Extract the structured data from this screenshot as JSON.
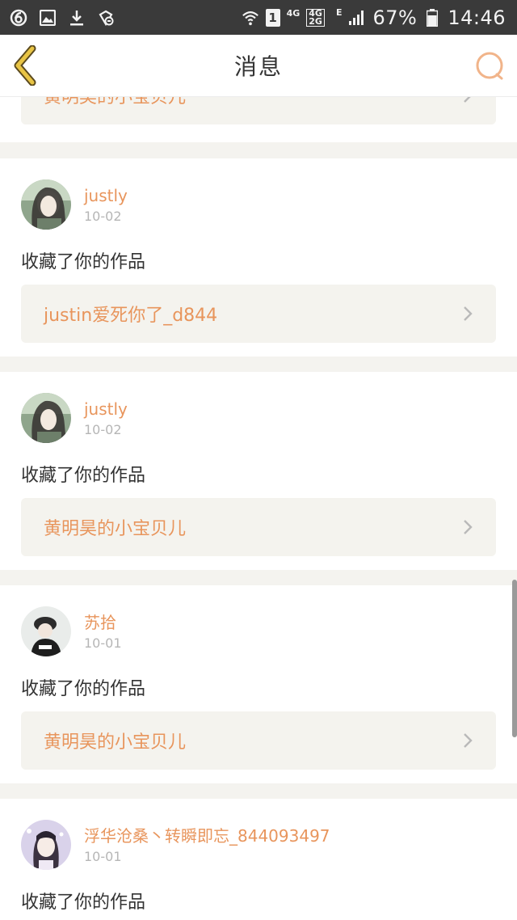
{
  "status_bar": {
    "network_small": "4G",
    "network_dual_top": "4G",
    "network_dual_bottom": "2G",
    "data_mode": "E",
    "sim_label": "1",
    "battery": "67%",
    "time": "14:46"
  },
  "header": {
    "title": "消息"
  },
  "colors": {
    "accent": "#e8955c",
    "back_arrow": "#d9b23a",
    "background": "#f4f3ef",
    "link_bg": "#f4f3ee"
  },
  "partial_card": {
    "work_title": "黄明昊的小宝贝儿"
  },
  "messages": [
    {
      "username": "justly",
      "date": "10-02",
      "action": "收藏了你的作品",
      "work_title": "justin爱死你了_d844"
    },
    {
      "username": "justly",
      "date": "10-02",
      "action": "收藏了你的作品",
      "work_title": "黄明昊的小宝贝儿"
    },
    {
      "username": "苏拾",
      "date": "10-01",
      "action": "收藏了你的作品",
      "work_title": "黄明昊的小宝贝儿"
    },
    {
      "username": "浮华沧桑丶转瞬即忘_844093497",
      "date": "10-01",
      "action": "收藏了你的作品"
    }
  ]
}
